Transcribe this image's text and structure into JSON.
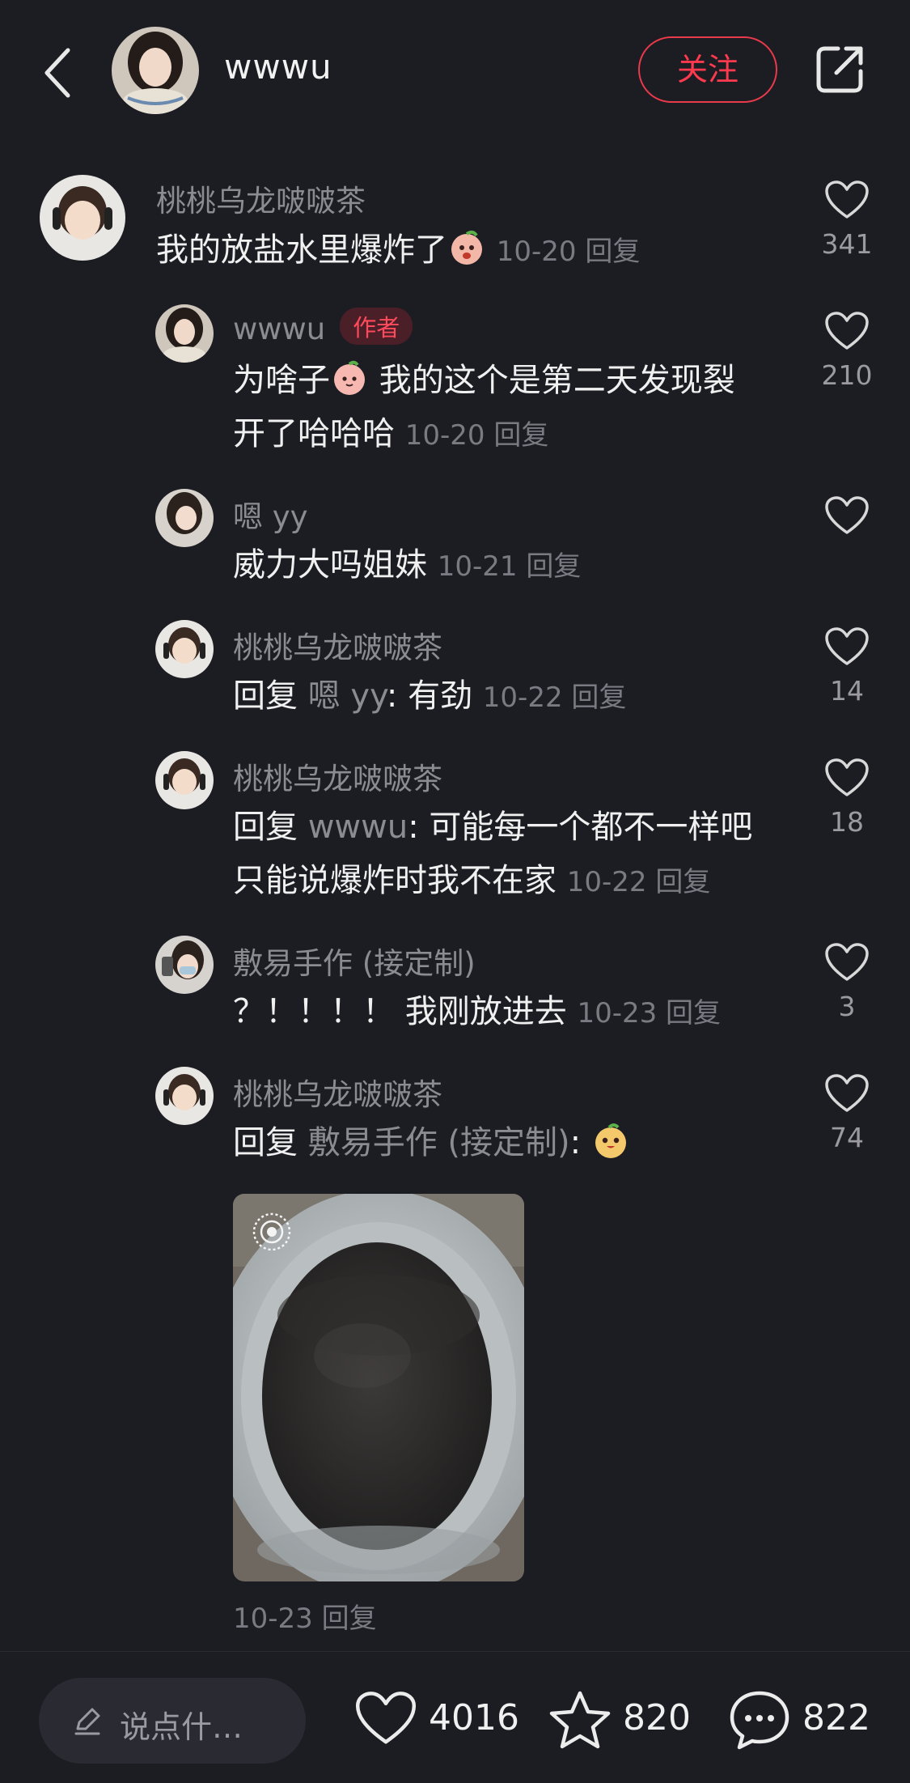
{
  "header": {
    "author_name": "wwwu",
    "follow_label": "关注"
  },
  "comments": {
    "c1": {
      "user": "桃桃乌龙啵啵茶",
      "text": "我的放盐水里爆炸了",
      "date": "10-20",
      "reply": "回复",
      "likes": "341"
    },
    "r1": {
      "user": "wwwu",
      "badge": "作者",
      "text_a": "为啥子",
      "text_b": "我的这个是第二天发现裂",
      "text_c": "开了哈哈哈",
      "date": "10-20",
      "reply": "回复",
      "likes": "210"
    },
    "r2": {
      "user": "嗯 yy",
      "text": "威力大吗姐妹",
      "date": "10-21",
      "reply": "回复"
    },
    "r3": {
      "user": "桃桃乌龙啵啵茶",
      "prefix": "回复",
      "ref": "嗯 yy",
      "text": ": 有劲",
      "date": "10-22",
      "reply": "回复",
      "likes": "14"
    },
    "r4": {
      "user": "桃桃乌龙啵啵茶",
      "prefix": "回复",
      "ref": "wwwu",
      "text": ": 可能每一个都不一样吧",
      "text2": "只能说爆炸时我不在家",
      "date": "10-22",
      "reply": "回复",
      "likes": "18"
    },
    "r5": {
      "user": "敷易手作 (接定制)",
      "text": "？！！！！ 我刚放进去",
      "date": "10-23",
      "reply": "回复",
      "likes": "3"
    },
    "r6": {
      "user": "桃桃乌龙啵啵茶",
      "prefix": "回复",
      "ref": "敷易手作 (接定制)",
      "text": ":",
      "date": "10-23",
      "reply": "回复",
      "likes": "74"
    }
  },
  "bottom": {
    "input_placeholder": "说点什…",
    "likes": "4016",
    "favorites": "820",
    "comments": "822"
  },
  "colors": {
    "background": "#1c1c23",
    "accent": "#ff3a4e"
  },
  "icons": [
    "back-icon",
    "share-icon",
    "heart-icon",
    "star-icon",
    "comment-bubble-icon",
    "pencil-icon",
    "live-photo-icon"
  ]
}
